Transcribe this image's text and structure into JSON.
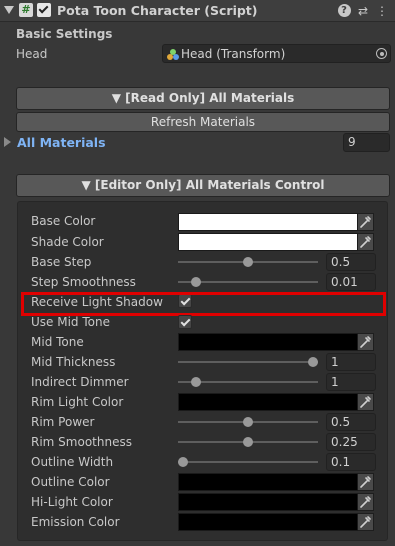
{
  "header": {
    "icon_text": "#",
    "title": "Pota Toon Character (Script)",
    "help_icon": "?",
    "preset_icon": "⇄",
    "menu_icon": "⋮"
  },
  "basic": {
    "section_label": "Basic Settings",
    "head_label": "Head",
    "head_value": "Head (Transform)"
  },
  "read_only_button": "▼ [Read Only] All Materials",
  "refresh_button": "Refresh Materials",
  "all_materials": {
    "label": "All Materials",
    "count": "9"
  },
  "editor_only_button": "▼ [Editor Only] All Materials Control",
  "properties": {
    "base_color": {
      "label": "Base Color",
      "color": "#ffffff"
    },
    "shade_color": {
      "label": "Shade Color",
      "color": "#ffffff"
    },
    "base_step": {
      "label": "Base Step",
      "value": "0.5",
      "fraction": 0.5
    },
    "step_smoothness": {
      "label": "Step Smoothness",
      "value": "0.01",
      "fraction": 0.1
    },
    "receive_light_shadow": {
      "label": "Receive Light Shadow",
      "checked": true
    },
    "use_mid_tone": {
      "label": "Use Mid Tone",
      "checked": true
    },
    "mid_tone": {
      "label": "Mid Tone",
      "color": "#000000"
    },
    "mid_thickness": {
      "label": "Mid Thickness",
      "value": "1",
      "fraction": 1.0
    },
    "indirect_dimmer": {
      "label": "Indirect Dimmer",
      "value": "1",
      "fraction": 0.1
    },
    "rim_light_color": {
      "label": "Rim Light Color",
      "color": "#000000"
    },
    "rim_power": {
      "label": "Rim Power",
      "value": "0.5",
      "fraction": 0.5
    },
    "rim_smoothness": {
      "label": "Rim Smoothness",
      "value": "0.25",
      "fraction": 0.5
    },
    "outline_width": {
      "label": "Outline Width",
      "value": "0.1",
      "fraction": 0.0
    },
    "outline_color": {
      "label": "Outline Color",
      "color": "#000000"
    },
    "hi_light_color": {
      "label": "Hi-Light Color",
      "color": "#000000"
    },
    "emission_color": {
      "label": "Emission Color",
      "color": "#000000"
    }
  }
}
